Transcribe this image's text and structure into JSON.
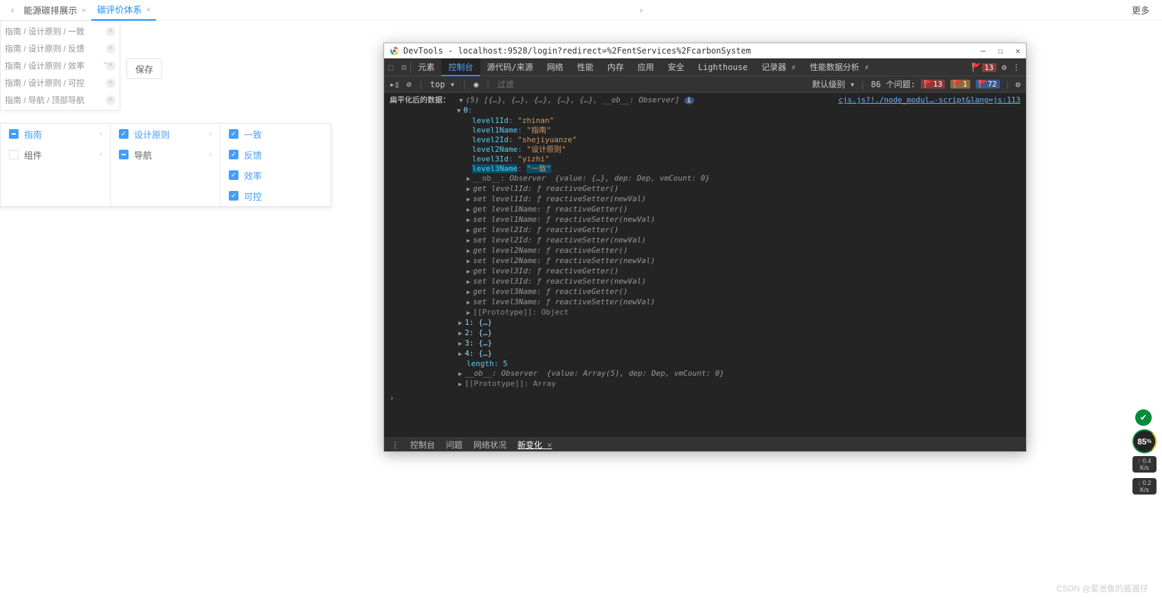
{
  "topbar": {
    "tab1": "能源碳排展示",
    "tab2": "碳评价体系",
    "more": "更多"
  },
  "tags": {
    "t0": "指南 / 设计原则 / 一致",
    "t1": "指南 / 设计原则 / 反馈",
    "t2": "指南 / 设计原则 / 效率",
    "t3": "指南 / 设计原则 / 可控",
    "t4": "指南 / 导航 / 顶部导航"
  },
  "saveBtn": "保存",
  "cascader": {
    "p0": {
      "i0": "指南",
      "i1": "组件"
    },
    "p1": {
      "i0": "设计原则",
      "i1": "导航"
    },
    "p2": {
      "i0": "一致",
      "i1": "反馈",
      "i2": "效率",
      "i3": "可控"
    }
  },
  "devtools": {
    "title": "DevTools - localhost:9528/login?redirect=%2FentServices%2FcarbonSystem",
    "tabs": {
      "t0": "元素",
      "t1": "控制台",
      "t2": "源代码/来源",
      "t3": "网络",
      "t4": "性能",
      "t5": "内存",
      "t6": "应用",
      "t7": "安全",
      "t8": "Lighthouse",
      "t9": "记录器 ⚡",
      "t10": "性能数据分析 ⚡"
    },
    "errorBadge": "13",
    "filter": {
      "top": "top",
      "placeholder": "过滤",
      "level": "默认级别",
      "issues": "86 个问题:",
      "red": "13",
      "yel": "1",
      "blue": "72"
    },
    "srcLink": "cjs.js?!./node_modul…-script&lang=js:113",
    "log": {
      "title": "扁平化后的数据：",
      "arr1": "(5) [{…}, {…}, {…}, {…}, {…}, __ob__: Observer]",
      "idx0": "0",
      "l1id_k": "level1Id",
      "l1id_v": "\"zhinan\"",
      "l1nm_k": "level1Name",
      "l1nm_v": "\"指南\"",
      "l2id_k": "level2Id",
      "l2id_v": "\"shejiyuanze\"",
      "l2nm_k": "level2Name",
      "l2nm_v": "\"设计原则\"",
      "l3id_k": "level3Id",
      "l3id_v": "\"yizhi\"",
      "l3nm_k": "level3Name",
      "l3nm_v": "\"一致\"",
      "ob_k": "__ob__",
      "ob_v": "Observer  {value: {…}, dep: Dep, vmCount: 0}",
      "g1": "get level1Id: ƒ reactiveGetter()",
      "s1": "set level1Id: ƒ reactiveSetter(newVal)",
      "g2": "get level1Name: ƒ reactiveGetter()",
      "s2": "set level1Name: ƒ reactiveSetter(newVal)",
      "g3": "get level2Id: ƒ reactiveGetter()",
      "s3": "set level2Id: ƒ reactiveSetter(newVal)",
      "g4": "get level2Name: ƒ reactiveGetter()",
      "s4": "set level2Name: ƒ reactiveSetter(newVal)",
      "g5": "get level3Id: ƒ reactiveGetter()",
      "s5": "set level3Id: ƒ reactiveSetter(newVal)",
      "g6": "get level3Name: ƒ reactiveGetter()",
      "s6": "set level3Name: ƒ reactiveSetter(newVal)",
      "proto0": "[[Prototype]]: Object",
      "i1": "1: {…}",
      "i2": "2: {…}",
      "i3": "3: {…}",
      "i4": "4: {…}",
      "len": "length: 5",
      "ob2": "__ob__: Observer  {value: Array(5), dep: Dep, vmCount: 0}",
      "proto1": "[[Prototype]]: Array"
    },
    "drawer": {
      "t0": "控制台",
      "t1": "问题",
      "t2": "网络状况",
      "t3": "新变化"
    }
  },
  "perf": {
    "score": "85",
    "pct": "%",
    "up": "0.4",
    "upunit": "K/s",
    "down": "0.2",
    "downunit": "K/s"
  },
  "watermark": "CSDN @爱池鱼的酱酱仔"
}
